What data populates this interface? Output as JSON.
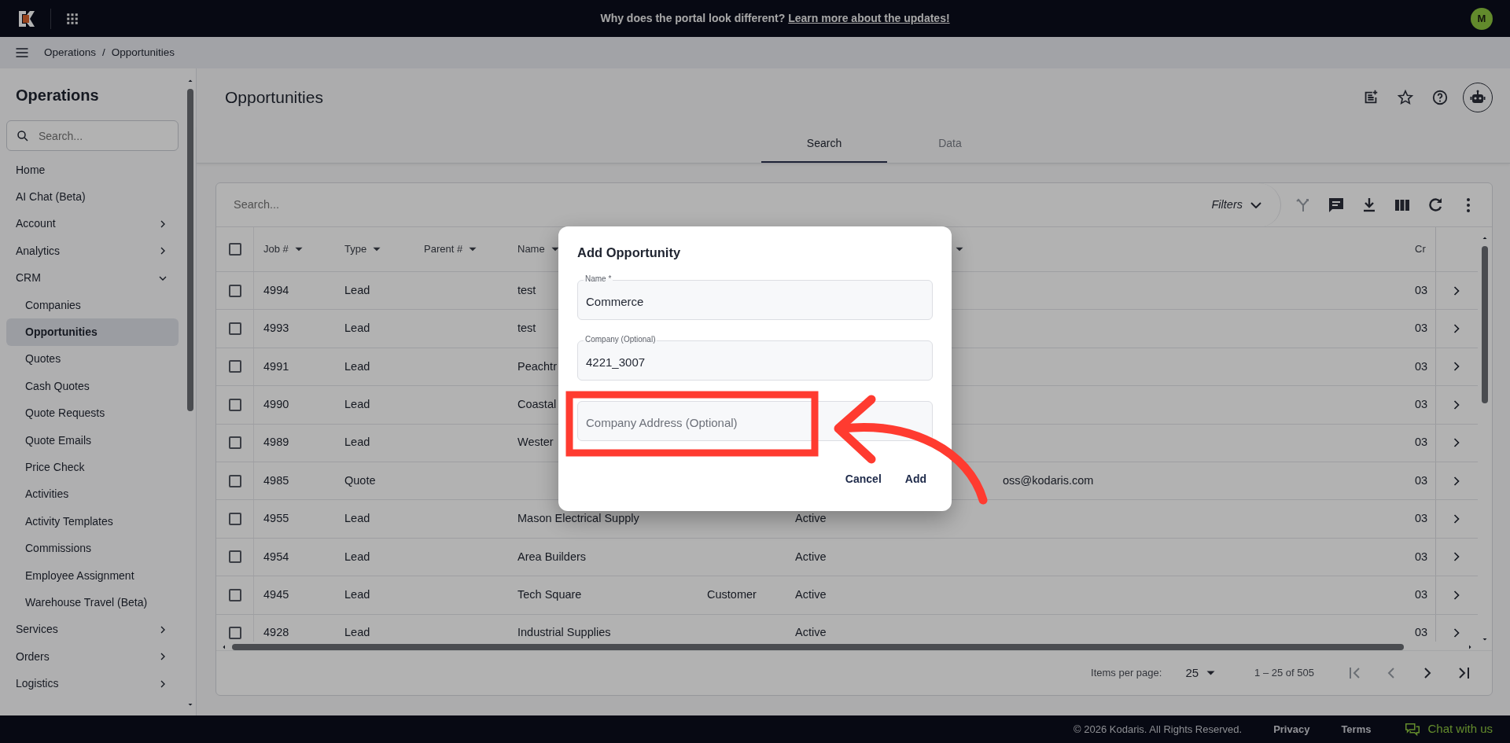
{
  "top_bar": {
    "banner_text": "Why does the portal look different?",
    "banner_link": "Learn more about the updates!",
    "avatar": "M"
  },
  "breadcrumb": {
    "items": [
      "Operations",
      "Opportunities"
    ],
    "separator": "/"
  },
  "sidebar": {
    "title": "Operations",
    "search_placeholder": "Search...",
    "items": [
      {
        "label": "Home",
        "selected": false
      },
      {
        "label": "AI Chat (Beta)",
        "selected": false
      },
      {
        "label": "Account",
        "selected": false,
        "expandable": true,
        "expanded": false
      },
      {
        "label": "Analytics",
        "selected": false,
        "expandable": true,
        "expanded": false
      },
      {
        "label": "CRM",
        "selected": false,
        "expandable": true,
        "expanded": true,
        "children": [
          {
            "label": "Companies",
            "selected": false
          },
          {
            "label": "Opportunities",
            "selected": true
          },
          {
            "label": "Quotes",
            "selected": false
          },
          {
            "label": "Cash Quotes",
            "selected": false
          },
          {
            "label": "Quote Requests",
            "selected": false
          },
          {
            "label": "Quote Emails",
            "selected": false
          },
          {
            "label": "Price Check",
            "selected": false
          },
          {
            "label": "Activities",
            "selected": false
          },
          {
            "label": "Activity Templates",
            "selected": false
          },
          {
            "label": "Commissions",
            "selected": false
          },
          {
            "label": "Employee Assignment",
            "selected": false
          },
          {
            "label": "Warehouse Travel (Beta)",
            "selected": false
          }
        ]
      },
      {
        "label": "Services",
        "selected": false,
        "expandable": true,
        "expanded": false
      },
      {
        "label": "Orders",
        "selected": false,
        "expandable": true,
        "expanded": false
      },
      {
        "label": "Logistics",
        "selected": false,
        "expandable": true,
        "expanded": false
      }
    ]
  },
  "page": {
    "title": "Opportunities",
    "header_actions": [
      {
        "kind": "note-add"
      },
      {
        "kind": "star"
      },
      {
        "kind": "help"
      },
      {
        "kind": "assistant"
      }
    ],
    "tabs": [
      {
        "label": "Search",
        "selected": true
      },
      {
        "label": "Data",
        "selected": false
      }
    ]
  },
  "table": {
    "search_placeholder": "Search...",
    "filters_label": "Filters",
    "toolbar_actions": [
      {
        "kind": "merge",
        "disabled": true
      },
      {
        "kind": "comment",
        "disabled": false
      },
      {
        "kind": "download",
        "disabled": false
      },
      {
        "kind": "columns",
        "disabled": false
      },
      {
        "kind": "refresh",
        "disabled": false
      },
      {
        "kind": "more",
        "disabled": false
      }
    ],
    "select_all_checked": false,
    "columns": [
      {
        "label": "Job #",
        "sortable": true
      },
      {
        "label": "Type",
        "sortable": true
      },
      {
        "label": "Parent #",
        "sortable": true
      },
      {
        "label": "Name",
        "sortable": true
      },
      {},
      {
        "sortable": true
      },
      {},
      {
        "label": "Cr",
        "sortable": false
      }
    ],
    "rows": [
      {
        "selected": false,
        "cells": [
          "4994",
          "Lead",
          null,
          "test",
          null,
          null,
          null,
          "03"
        ]
      },
      {
        "selected": false,
        "cells": [
          "4993",
          "Lead",
          null,
          "test",
          null,
          null,
          null,
          "03"
        ]
      },
      {
        "selected": false,
        "cells": [
          "4991",
          "Lead",
          null,
          "Peachtr",
          null,
          null,
          null,
          "03"
        ]
      },
      {
        "selected": false,
        "cells": [
          "4990",
          "Lead",
          null,
          "Coastal",
          null,
          null,
          null,
          "03"
        ]
      },
      {
        "selected": false,
        "cells": [
          "4989",
          "Lead",
          null,
          "Wester",
          null,
          null,
          null,
          "03"
        ]
      },
      {
        "selected": false,
        "cells": [
          "4985",
          "Quote",
          null,
          null,
          null,
          null,
          "oss@kodaris.com",
          "03"
        ]
      },
      {
        "selected": false,
        "cells": [
          "4955",
          "Lead",
          null,
          "Mason Electrical Supply",
          null,
          "Active",
          null,
          "03"
        ]
      },
      {
        "selected": false,
        "cells": [
          "4954",
          "Lead",
          null,
          "Area Builders",
          null,
          "Active",
          null,
          "03"
        ]
      },
      {
        "selected": false,
        "cells": [
          "4945",
          "Lead",
          null,
          "Tech Square",
          "Customer",
          "Active",
          null,
          "03"
        ]
      },
      {
        "selected": false,
        "cells": [
          "4928",
          "Lead",
          null,
          "Industrial Supplies",
          null,
          "Active",
          null,
          "03"
        ]
      }
    ],
    "pagination": {
      "items_per_page_label": "Items per page:",
      "page_size": "25",
      "range": "1 – 25 of 505",
      "nav": [
        {
          "kind": "first",
          "disabled": true
        },
        {
          "kind": "previous",
          "disabled": true
        },
        {
          "kind": "next",
          "disabled": false
        },
        {
          "kind": "last",
          "disabled": false
        }
      ]
    }
  },
  "dialog": {
    "title": "Add Opportunity",
    "fields": [
      {
        "label": "Name *",
        "value": "Commerce"
      },
      {
        "label": "Company (Optional)",
        "value": "4221_3007"
      },
      {
        "placeholder": "Company Address (Optional)"
      }
    ],
    "buttons": [
      "Cancel",
      "Add"
    ]
  },
  "annotation": {
    "box": true,
    "arrow": true
  },
  "footer": {
    "copyright": "© 2026 Kodaris. All Rights Reserved.",
    "links": [
      "Privacy",
      "Terms"
    ],
    "chat": "Chat with us"
  }
}
